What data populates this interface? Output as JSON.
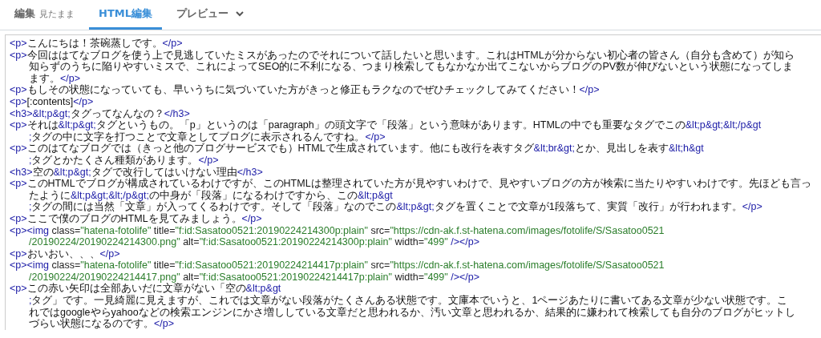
{
  "tabs": [
    {
      "label": "編集",
      "sublabel": "見たまま",
      "selected": false,
      "dropdown": false
    },
    {
      "label": "HTML編集",
      "selected": true,
      "dropdown": false
    },
    {
      "label": "プレビュー",
      "selected": false,
      "dropdown": true
    }
  ],
  "editor": {
    "lines": [
      {
        "continuation": false,
        "segments": [
          {
            "kind": "tag",
            "text": "<p>"
          },
          {
            "kind": "text",
            "text": "こんにちは！茶碗蒸しです。"
          },
          {
            "kind": "tag",
            "text": "</p>"
          }
        ]
      },
      {
        "continuation": false,
        "segments": [
          {
            "kind": "tag",
            "text": "<p>"
          },
          {
            "kind": "text",
            "text": "今回ははてなブログを使う上で見逃していたミスがあったのでそれについて話したいと思います。これはHTMLが分からない初心者の皆さん（自分も含めて）が知ら"
          }
        ]
      },
      {
        "continuation": true,
        "segments": [
          {
            "kind": "text",
            "text": "知らずのうちに陥りやすいミスで、これによってSEO的に不利になる、つまり検索してもなかなか出てこないからブログのPV数が伸びないという状態になってしま"
          }
        ]
      },
      {
        "continuation": true,
        "segments": [
          {
            "kind": "text",
            "text": "ます。"
          },
          {
            "kind": "tag",
            "text": "</p>"
          }
        ]
      },
      {
        "continuation": false,
        "segments": [
          {
            "kind": "tag",
            "text": "<p>"
          },
          {
            "kind": "text",
            "text": "もしその状態になっていても、早いうちに気づいていた方がきっと修正もラクなのでぜひチェックしてみてください！"
          },
          {
            "kind": "tag",
            "text": "</p>"
          }
        ]
      },
      {
        "continuation": false,
        "segments": [
          {
            "kind": "tag",
            "text": "<p>"
          },
          {
            "kind": "text",
            "text": "[:contents]"
          },
          {
            "kind": "tag",
            "text": "</p>"
          }
        ]
      },
      {
        "continuation": false,
        "segments": [
          {
            "kind": "tag",
            "text": "<h3>"
          },
          {
            "kind": "entity",
            "text": "&lt;p&gt;"
          },
          {
            "kind": "text",
            "text": "タグってなんなの？"
          },
          {
            "kind": "tag",
            "text": "</h3>"
          }
        ]
      },
      {
        "continuation": false,
        "segments": [
          {
            "kind": "tag",
            "text": "<p>"
          },
          {
            "kind": "text",
            "text": "それは"
          },
          {
            "kind": "entity",
            "text": "&lt;p&gt;"
          },
          {
            "kind": "text",
            "text": "タグというもの。「p」というのは「paragraph」の頭文字で「段落」という意味があります。HTMLの中でも重要なタグでこの"
          },
          {
            "kind": "entity",
            "text": "&lt;p&gt;&lt;/p&gt"
          }
        ]
      },
      {
        "continuation": true,
        "segments": [
          {
            "kind": "entity",
            "text": ";"
          },
          {
            "kind": "text",
            "text": "タグの中に文字を打つことで文章としてブログに表示されるんですね。"
          },
          {
            "kind": "tag",
            "text": "</p>"
          }
        ]
      },
      {
        "continuation": false,
        "segments": [
          {
            "kind": "tag",
            "text": "<p>"
          },
          {
            "kind": "text",
            "text": "このはてなブログでは（きっと他のブログサービスでも）HTMLで生成されています。他にも改行を表すタグ"
          },
          {
            "kind": "entity",
            "text": "&lt;br&gt;"
          },
          {
            "kind": "text",
            "text": "とか、見出しを表す"
          },
          {
            "kind": "entity",
            "text": "&lt;h&gt"
          }
        ]
      },
      {
        "continuation": true,
        "segments": [
          {
            "kind": "entity",
            "text": ";"
          },
          {
            "kind": "text",
            "text": "タグとかたくさん種類があります。"
          },
          {
            "kind": "tag",
            "text": "</p>"
          }
        ]
      },
      {
        "continuation": false,
        "segments": [
          {
            "kind": "tag",
            "text": "<h3>"
          },
          {
            "kind": "text",
            "text": "空の"
          },
          {
            "kind": "entity",
            "text": "&lt;p&gt;"
          },
          {
            "kind": "text",
            "text": "タグで改行してはいけない理由"
          },
          {
            "kind": "tag",
            "text": "</h3>"
          }
        ]
      },
      {
        "continuation": false,
        "segments": [
          {
            "kind": "tag",
            "text": "<p>"
          },
          {
            "kind": "text",
            "text": "このHTMLでブログが構成されているわけですが、このHTMLは整理されていた方が見やすいわけで、見やすいブログの方が検索に当たりやすいわけです。先ほども言っ"
          }
        ]
      },
      {
        "continuation": true,
        "segments": [
          {
            "kind": "text",
            "text": "たように"
          },
          {
            "kind": "entity",
            "text": "&lt;p&gt;&lt;/p&gt;"
          },
          {
            "kind": "text",
            "text": "の中身が「段落」になるわけですから、この"
          },
          {
            "kind": "entity",
            "text": "&lt;p&gt"
          }
        ]
      },
      {
        "continuation": true,
        "segments": [
          {
            "kind": "entity",
            "text": ";"
          },
          {
            "kind": "text",
            "text": "タグの間には当然「文章」が入ってくるわけです。そして「段落」なのでこの"
          },
          {
            "kind": "entity",
            "text": "&lt;p&gt;"
          },
          {
            "kind": "text",
            "text": "タグを置くことで文章が1段落ちて、実質「改行」が行われます。"
          },
          {
            "kind": "tag",
            "text": "</p>"
          }
        ]
      },
      {
        "continuation": false,
        "segments": [
          {
            "kind": "tag",
            "text": "<p>"
          },
          {
            "kind": "text",
            "text": "ここで僕のブログのHTMLを見てみましょう。"
          },
          {
            "kind": "tag",
            "text": "</p>"
          }
        ]
      },
      {
        "continuation": false,
        "segments": [
          {
            "kind": "tag",
            "text": "<p><img"
          },
          {
            "kind": "attr",
            "text": " class="
          },
          {
            "kind": "value",
            "text": "\"hatena-fotolife\""
          },
          {
            "kind": "attr",
            "text": " title="
          },
          {
            "kind": "value",
            "text": "\"f:id:Sasatoo0521:20190224214300p:plain\""
          },
          {
            "kind": "attr",
            "text": " src="
          },
          {
            "kind": "value",
            "text": "\"https://cdn-ak.f.st-hatena.com/images/fotolife/S/Sasatoo0521"
          }
        ]
      },
      {
        "continuation": true,
        "segments": [
          {
            "kind": "value",
            "text": "/20190224/20190224214300.png\""
          },
          {
            "kind": "attr",
            "text": " alt="
          },
          {
            "kind": "value",
            "text": "\"f:id:Sasatoo0521:20190224214300p:plain\""
          },
          {
            "kind": "attr",
            "text": " width="
          },
          {
            "kind": "value",
            "text": "\"499\""
          },
          {
            "kind": "tag",
            "text": " /></p>"
          }
        ]
      },
      {
        "continuation": false,
        "segments": [
          {
            "kind": "tag",
            "text": "<p>"
          },
          {
            "kind": "text",
            "text": "おいおい、、、"
          },
          {
            "kind": "tag",
            "text": "</p>"
          }
        ]
      },
      {
        "continuation": false,
        "segments": [
          {
            "kind": "tag",
            "text": "<p><img"
          },
          {
            "kind": "attr",
            "text": " class="
          },
          {
            "kind": "value",
            "text": "\"hatena-fotolife\""
          },
          {
            "kind": "attr",
            "text": " title="
          },
          {
            "kind": "value",
            "text": "\"f:id:Sasatoo0521:20190224214417p:plain\""
          },
          {
            "kind": "attr",
            "text": " src="
          },
          {
            "kind": "value",
            "text": "\"https://cdn-ak.f.st-hatena.com/images/fotolife/S/Sasatoo0521"
          }
        ]
      },
      {
        "continuation": true,
        "segments": [
          {
            "kind": "value",
            "text": "/20190224/20190224214417.png\""
          },
          {
            "kind": "attr",
            "text": " alt="
          },
          {
            "kind": "value",
            "text": "\"f:id:Sasatoo0521:20190224214417p:plain\""
          },
          {
            "kind": "attr",
            "text": " width="
          },
          {
            "kind": "value",
            "text": "\"499\""
          },
          {
            "kind": "tag",
            "text": " /></p>"
          }
        ]
      },
      {
        "continuation": false,
        "segments": [
          {
            "kind": "tag",
            "text": "<p>"
          },
          {
            "kind": "text",
            "text": "この赤い矢印は全部あいだに文章がない「空の"
          },
          {
            "kind": "entity",
            "text": "&lt;p&gt"
          }
        ]
      },
      {
        "continuation": true,
        "segments": [
          {
            "kind": "entity",
            "text": ";"
          },
          {
            "kind": "text",
            "text": "タグ」です。一見綺麗に見えますが、これでは文章がない段落がたくさんある状態です。文庫本でいうと、1ページあたりに書いてある文章が少ない状態です。こ"
          }
        ]
      },
      {
        "continuation": true,
        "segments": [
          {
            "kind": "text",
            "text": "れではgoogleやらyahooなどの検索エンジンにかさ増ししている文章だと思われるか、汚い文章と思われるか、結果的に嫌われて検索しても自分のブログがヒットし"
          }
        ]
      },
      {
        "continuation": true,
        "segments": [
          {
            "kind": "text",
            "text": "づらい状態になるのです。"
          },
          {
            "kind": "tag",
            "text": "</p>"
          }
        ]
      }
    ]
  }
}
